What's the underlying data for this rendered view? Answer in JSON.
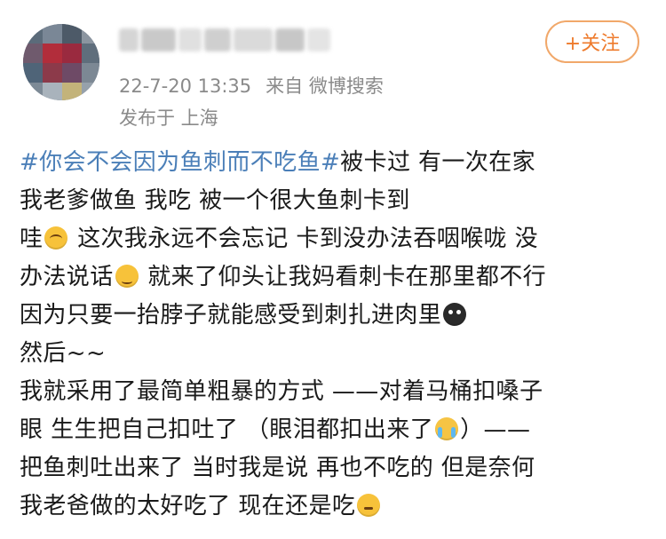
{
  "header": {
    "timestamp": "22-7-20 13:35",
    "source": "来自 微博搜索",
    "location": "发布于 上海",
    "follow_label": "+关注"
  },
  "post": {
    "lines": [
      {
        "hashtag": "#你会不会因为鱼刺而不吃鱼#",
        "text": "被卡过 有一次在家"
      },
      {
        "text": "我老爹做鱼 我吃 被一个很大鱼刺卡到"
      },
      {
        "pre": "哇",
        "emoji": "sad-face-icon",
        "post": " 这次我永远不会忘记 卡到没办法吞咽喉咙  没"
      },
      {
        "pre": "办法说话",
        "emoji": "sweat-smile-icon",
        "post": " 就来了仰头让我妈看刺卡在那里都不行"
      },
      {
        "pre": "因为只要一抬脖子就能感受到刺扎进肉里",
        "emoji": "black-cry-icon",
        "post": ""
      },
      {
        "text": "然后~~"
      },
      {
        "text": "我就采用了最简单粗暴的方式 ——对着马桶扣嗓子"
      },
      {
        "pre": "眼 生生把自己扣吐了 （眼泪都扣出来了",
        "emoji": "crying-icon",
        "post": "）——"
      },
      {
        "text": "把鱼刺吐出来了 当时我是说 再也不吃的 但是奈何"
      },
      {
        "pre": "我老爸做的太好吃了 现在还是吃",
        "emoji": "thinking-icon",
        "post": ""
      }
    ]
  },
  "colors": {
    "hashtag": "#4b7fb8",
    "follow_border": "#f1a86a",
    "follow_text": "#ee7a2b",
    "meta_text": "#8a8a8a"
  }
}
